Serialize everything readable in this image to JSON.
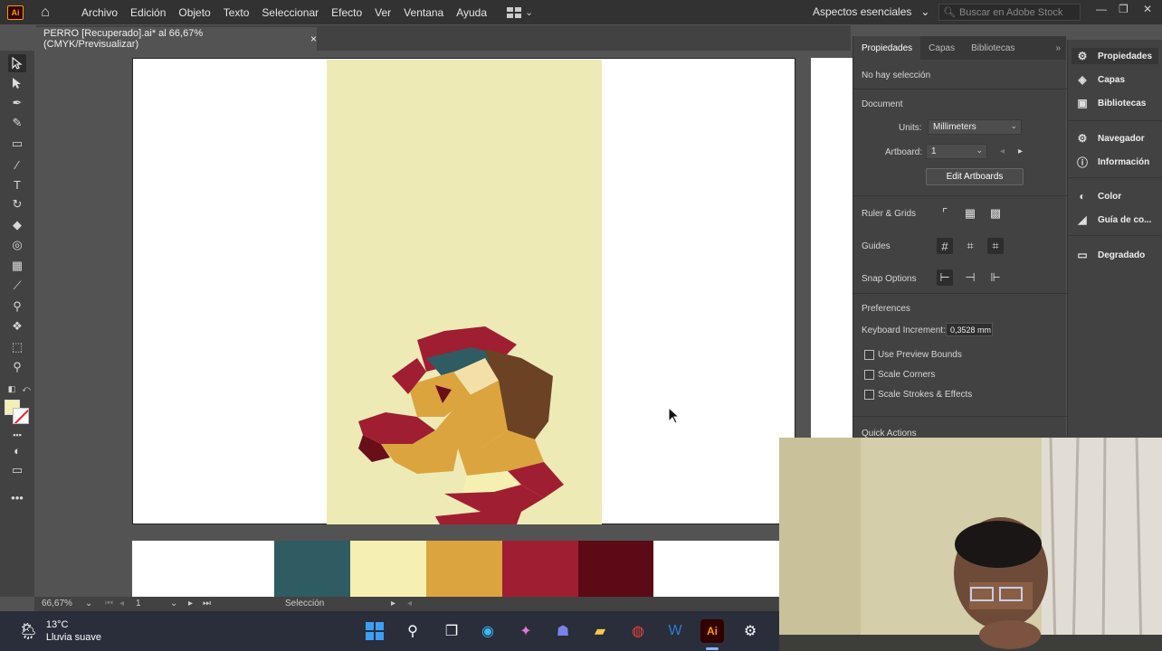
{
  "menubar": {
    "app_icon": "Ai",
    "items": [
      "Archivo",
      "Edición",
      "Objeto",
      "Texto",
      "Seleccionar",
      "Efecto",
      "Ver",
      "Ventana",
      "Ayuda"
    ],
    "workspace": "Aspectos esenciales",
    "stock_placeholder": "Buscar en Adobe Stock"
  },
  "document_tab": {
    "title": "PERRO [Recuperado].ai* al 66,67% (CMYK/Previsualizar)",
    "close": "×"
  },
  "palette_colors": [
    "#2f5b63",
    "#f5f0b2",
    "#dba43f",
    "#a01e32",
    "#5c0a16"
  ],
  "properties": {
    "tabs": [
      "Propiedades",
      "Capas",
      "Bibliotecas"
    ],
    "no_selection": "No hay selección",
    "document_heading": "Document",
    "units_label": "Units:",
    "units_value": "Millimeters",
    "artboard_label": "Artboard:",
    "artboard_value": "1",
    "edit_artboards": "Edit Artboards",
    "ruler_grids": "Ruler & Grids",
    "guides": "Guides",
    "snap_options": "Snap Options",
    "preferences": "Preferences",
    "keyboard_increment_label": "Keyboard Increment:",
    "keyboard_increment_value": "0,3528 mm",
    "use_preview_bounds": "Use Preview Bounds",
    "scale_corners": "Scale Corners",
    "scale_strokes": "Scale Strokes & Effects",
    "quick_actions": "Quick Actions"
  },
  "right_panel": {
    "items": [
      "Propiedades",
      "Capas",
      "Bibliotecas",
      "Navegador",
      "Información",
      "Color",
      "Guía de co...",
      "Degradado"
    ]
  },
  "statusbar": {
    "zoom": "66,67%",
    "artboard": "1",
    "tool": "Selección"
  },
  "taskbar": {
    "temperature": "13°C",
    "weather": "Lluvia suave"
  }
}
